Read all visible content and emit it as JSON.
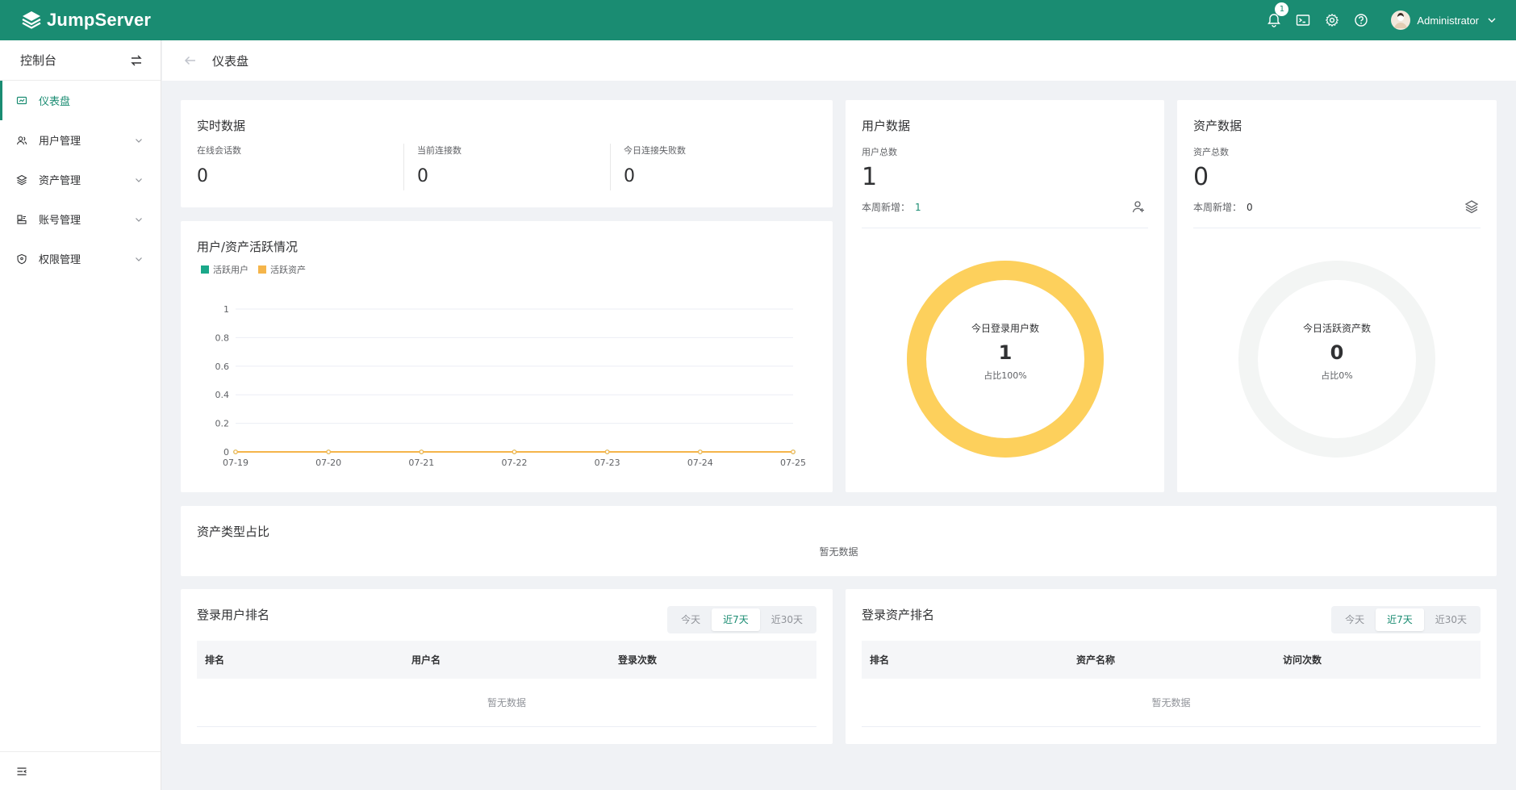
{
  "app": {
    "name": "JumpServer"
  },
  "topbar": {
    "notification_count": "1",
    "user_name": "Administrator"
  },
  "sidebar": {
    "title": "控制台",
    "items": [
      {
        "label": "仪表盘",
        "icon": "dashboard-icon",
        "active": true
      },
      {
        "label": "用户管理",
        "icon": "users-icon"
      },
      {
        "label": "资产管理",
        "icon": "layers-icon"
      },
      {
        "label": "账号管理",
        "icon": "account-icon"
      },
      {
        "label": "权限管理",
        "icon": "shield-icon"
      }
    ]
  },
  "page": {
    "title": "仪表盘"
  },
  "realtime": {
    "title": "实时数据",
    "stats": [
      {
        "label": "在线会话数",
        "value": "0"
      },
      {
        "label": "当前连接数",
        "value": "0"
      },
      {
        "label": "今日连接失败数",
        "value": "0"
      }
    ]
  },
  "activity": {
    "title": "用户/资产活跃情况",
    "legend": [
      {
        "name": "活跃用户",
        "color": "#1aa889"
      },
      {
        "name": "活跃资产",
        "color": "#f5b54a"
      }
    ]
  },
  "chart_data": {
    "type": "line",
    "title": "用户/资产活跃情况",
    "x": [
      "07-19",
      "07-20",
      "07-21",
      "07-22",
      "07-23",
      "07-24",
      "07-25"
    ],
    "series": [
      {
        "name": "活跃用户",
        "values": [
          0,
          0,
          0,
          0,
          0,
          0,
          0
        ]
      },
      {
        "name": "活跃资产",
        "values": [
          0,
          0,
          0,
          0,
          0,
          0,
          0
        ]
      }
    ],
    "yticks": [
      "0",
      "0.2",
      "0.4",
      "0.6",
      "0.8",
      "1"
    ],
    "ylim": [
      0,
      1
    ],
    "grid": true,
    "legend": "top-left"
  },
  "user_data": {
    "title": "用户数据",
    "total_label": "用户总数",
    "total": "1",
    "week_label": "本周新增：",
    "week_value": "1",
    "donut": {
      "title": "今日登录用户数",
      "value": "1",
      "percent": "占比100%",
      "fraction": 1,
      "color": "#fdd05c"
    }
  },
  "asset_data": {
    "title": "资产数据",
    "total_label": "资产总数",
    "total": "0",
    "week_label": "本周新增：",
    "week_value": "0",
    "donut": {
      "title": "今日活跃资产数",
      "value": "0",
      "percent": "占比0%",
      "fraction": 0,
      "color": "#f3f5f4"
    }
  },
  "asset_types": {
    "title": "资产类型占比",
    "empty": "暂无数据"
  },
  "user_rank": {
    "title": "登录用户排名",
    "tabs": [
      "今天",
      "近7天",
      "近30天"
    ],
    "active_tab": 1,
    "columns": [
      "排名",
      "用户名",
      "登录次数"
    ],
    "empty": "暂无数据"
  },
  "asset_rank": {
    "title": "登录资产排名",
    "tabs": [
      "今天",
      "近7天",
      "近30天"
    ],
    "active_tab": 1,
    "columns": [
      "排名",
      "资产名称",
      "访问次数"
    ],
    "empty": "暂无数据"
  }
}
